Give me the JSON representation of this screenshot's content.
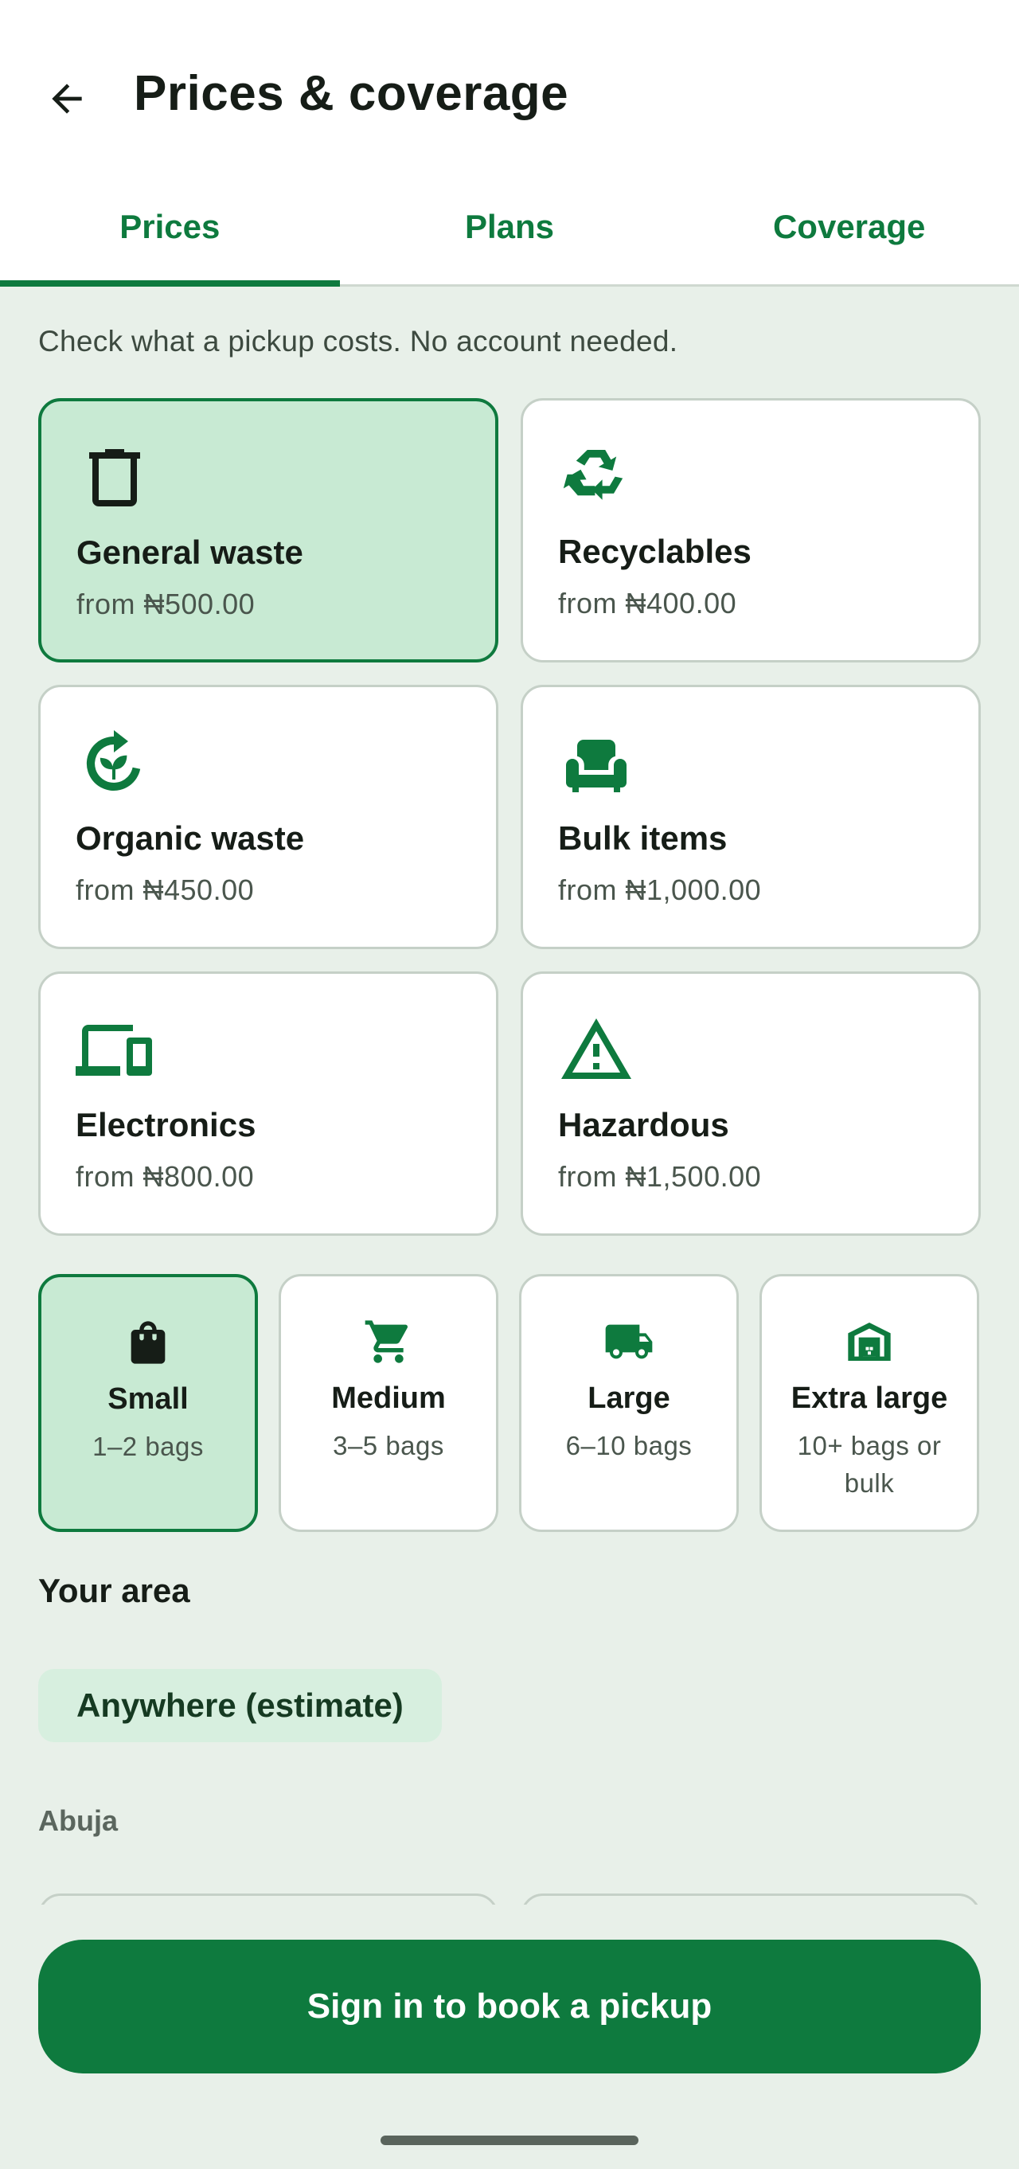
{
  "header": {
    "title": "Prices & coverage"
  },
  "tabs": [
    {
      "label": "Prices",
      "active": true
    },
    {
      "label": "Plans",
      "active": false
    },
    {
      "label": "Coverage",
      "active": false
    }
  ],
  "intro": "Check what a pickup costs. No account needed.",
  "categories": [
    {
      "name": "General waste",
      "price": "from ₦500.00",
      "icon": "trash-icon",
      "selected": true
    },
    {
      "name": "Recyclables",
      "price": "from ₦400.00",
      "icon": "recycle-icon",
      "selected": false
    },
    {
      "name": "Organic waste",
      "price": "from ₦450.00",
      "icon": "compost-icon",
      "selected": false
    },
    {
      "name": "Bulk items",
      "price": "from ₦1,000.00",
      "icon": "sofa-icon",
      "selected": false
    },
    {
      "name": "Electronics",
      "price": "from ₦800.00",
      "icon": "devices-icon",
      "selected": false
    },
    {
      "name": "Hazardous",
      "price": "from ₦1,500.00",
      "icon": "warning-icon",
      "selected": false
    }
  ],
  "sizes": [
    {
      "name": "Small",
      "desc": "1–2 bags",
      "icon": "bag-icon",
      "selected": true
    },
    {
      "name": "Medium",
      "desc": "3–5 bags",
      "icon": "cart-icon",
      "selected": false
    },
    {
      "name": "Large",
      "desc": "6–10 bags",
      "icon": "truck-icon",
      "selected": false
    },
    {
      "name": "Extra large",
      "desc": "10+ bags or bulk",
      "icon": "warehouse-icon",
      "selected": false
    }
  ],
  "area": {
    "heading": "Your area",
    "chip": "Anywhere (estimate)",
    "city": "Abuja"
  },
  "cta": {
    "label": "Sign in to book a pickup"
  },
  "colors": {
    "primary": "#0e7a3e",
    "background": "#e8f0e9",
    "selected_fill": "#c8ead3",
    "chip_fill": "#d7efdf"
  }
}
